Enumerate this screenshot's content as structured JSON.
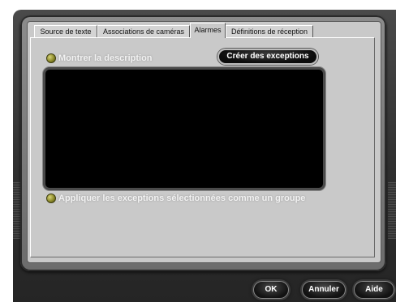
{
  "tabs": [
    {
      "label": "Source de texte"
    },
    {
      "label": "Associations de caméras"
    },
    {
      "label": "Alarmes",
      "active": true
    },
    {
      "label": "Définitions de réception"
    }
  ],
  "alarms": {
    "show_description_label": "Montrer la description",
    "create_exceptions_label": "Créer des exceptions",
    "apply_group_label": "Appliquer les exceptions sélectionnées comme un groupe"
  },
  "footer": {
    "ok_label": "OK",
    "cancel_label": "Annuler",
    "help_label": "Aide"
  },
  "colors": {
    "frame": "#333333",
    "panel": "#c9c9c9",
    "radio": "#8c8a2a",
    "button": "#0c0c0c"
  }
}
